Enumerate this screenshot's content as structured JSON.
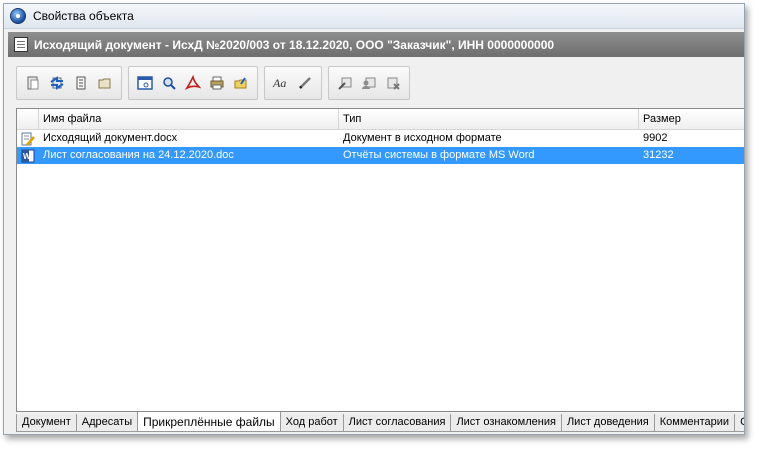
{
  "window": {
    "title": "Свойства объекта"
  },
  "header": {
    "title": "Исходящий документ - ИсхД №2020/003 от 18.12.2020, ООО \"Заказчик\", ИНН 0000000000"
  },
  "toolbar": {
    "groups": [
      [
        "document-props-icon",
        "refresh-arrows-icon",
        "register-book-icon",
        "folder-icon"
      ],
      [
        "preview-icon",
        "search-icon",
        "pdf-icon",
        "print-icon",
        "export-icon"
      ],
      [
        "font-icon",
        "pen-icon"
      ],
      [
        "sign-icon",
        "sign-user-icon",
        "remove-sign-icon"
      ]
    ]
  },
  "file_list": {
    "columns": [
      "Имя файла",
      "Тип",
      "Размер"
    ],
    "rows": [
      {
        "icon": "edit-document-icon",
        "name": "Исходящий документ.docx",
        "type": "Документ в исходном формате",
        "size": "9902",
        "selected": false
      },
      {
        "icon": "word-document-icon",
        "name": "Лист  согласования на 24.12.2020.doc",
        "type": "Отчёты системы в формате MS Word",
        "size": "31232",
        "selected": true
      }
    ]
  },
  "tabs": [
    {
      "label": "Документ",
      "active": false
    },
    {
      "label": "Адресаты",
      "active": false
    },
    {
      "label": "Прикреплённые файлы",
      "active": true
    },
    {
      "label": "Ход работ",
      "active": false
    },
    {
      "label": "Лист согласования",
      "active": false
    },
    {
      "label": "Лист ознакомления",
      "active": false
    },
    {
      "label": "Лист доведения",
      "active": false
    },
    {
      "label": "Комментарии",
      "active": false
    },
    {
      "label": "Св",
      "active": false
    }
  ],
  "colors": {
    "selection": "#3399ff",
    "header_bar": "#7a7a7a"
  }
}
